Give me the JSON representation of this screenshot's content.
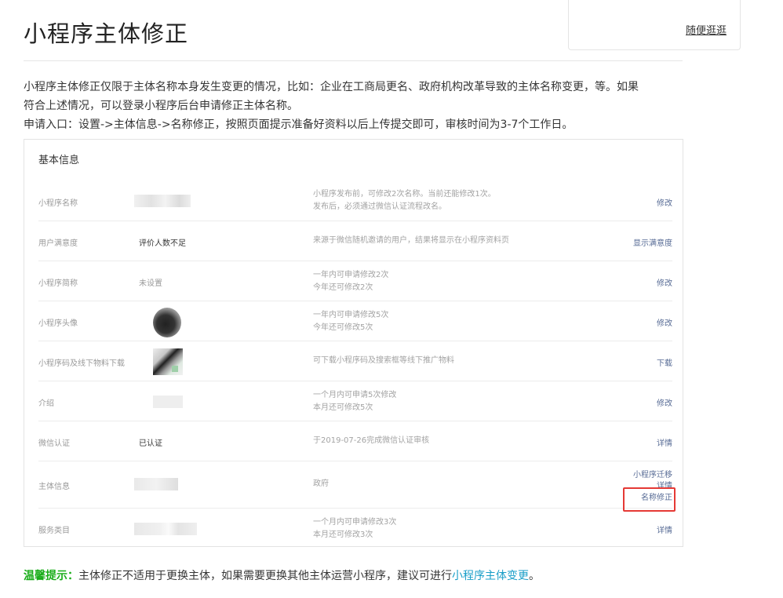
{
  "float_card": {
    "link": "随便逛逛"
  },
  "page_title": "小程序主体修正",
  "intro": {
    "line1": "小程序主体修正仅限于主体名称本身发生变更的情况，比如：企业在工商局更名、政府机构改革导致的主体名称变更，等。如果",
    "line2": "符合上述情况，可以登录小程序后台申请修正主体名称。",
    "line3": "申请入口：设置->主体信息->名称修正，按照页面提示准备好资料以后上传提交即可，审核时间为3-7个工作日。"
  },
  "panel": {
    "title": "基本信息",
    "rows": [
      {
        "label": "小程序名称",
        "value": "",
        "desc1": "小程序发布前，可修改2次名称。当前还能修改1次。",
        "desc2": "发布后，必须通过微信认证流程改名。",
        "action": "修改"
      },
      {
        "label": "用户满意度",
        "value": "评价人数不足",
        "desc1": "来源于微信随机邀请的用户，结果将显示在小程序资料页",
        "desc2": "",
        "action": "显示满意度"
      },
      {
        "label": "小程序简称",
        "value": "未设置",
        "desc1": "一年内可申请修改2次",
        "desc2": "今年还可修改2次",
        "action": "修改"
      },
      {
        "label": "小程序头像",
        "value": "",
        "desc1": "一年内可申请修改5次",
        "desc2": "今年还可修改5次",
        "action": "修改"
      },
      {
        "label": "小程序码及线下物料下载",
        "value": "",
        "desc1": "可下载小程序码及搜索框等线下推广物料",
        "desc2": "",
        "action": "下载"
      },
      {
        "label": "介绍",
        "value": "",
        "desc1": "一个月内可申请5次修改",
        "desc2": "本月还可修改5次",
        "action": "修改"
      },
      {
        "label": "微信认证",
        "value": "已认证",
        "desc1": "于2019-07-26完成微信认证审核",
        "desc2": "",
        "action": "详情"
      },
      {
        "label": "主体信息",
        "value": "",
        "desc1": "政府",
        "desc2": "",
        "action": "小程序迁移",
        "action2": "详情",
        "action3": "名称修正"
      },
      {
        "label": "服务类目",
        "value": "",
        "desc1": "一个月内可申请修改3次",
        "desc2": "本月还可修改3次",
        "action": "详情"
      }
    ]
  },
  "tip": {
    "label": "温馨提示：",
    "text": "主体修正不适用于更换主体，如果需要更换其他主体运营小程序，建议可进行",
    "link": "小程序主体变更",
    "suffix": "。"
  },
  "colors": {
    "link_blue": "#576b95",
    "tip_green": "#1aad19",
    "tip_link": "#1a9ec8",
    "highlight_red": "#e53935"
  }
}
